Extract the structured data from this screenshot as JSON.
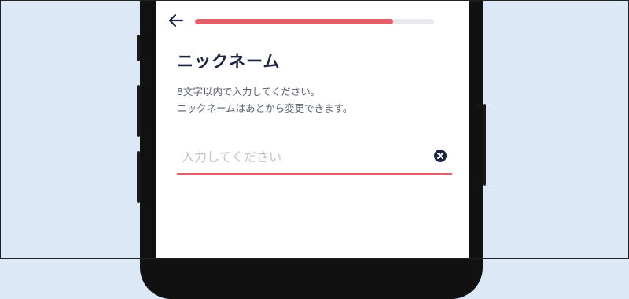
{
  "header": {
    "back_icon": "arrow-left-icon",
    "progress_fraction": 0.83,
    "progress_color": "#e35f6b",
    "progress_track_color": "#e8e9ec"
  },
  "main": {
    "title": "ニックネーム",
    "description_line1": "8文字以内で入力してください。",
    "description_line2": "ニックネームはあとから変更できます。",
    "nickname_input": {
      "value": "",
      "placeholder": "入力してください",
      "clear_icon": "close-circle-icon"
    }
  },
  "colors": {
    "background": "#dce8f5",
    "accent": "#e35f6b",
    "title_text": "#1b2540"
  }
}
